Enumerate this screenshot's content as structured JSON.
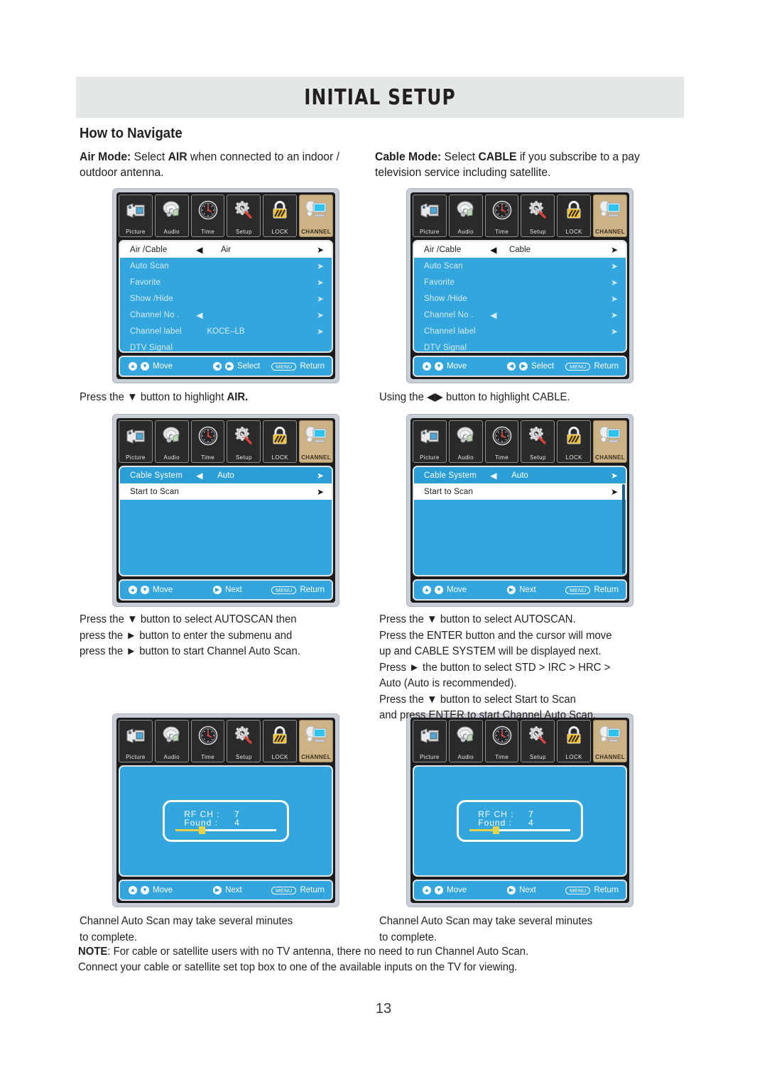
{
  "header": {
    "title": "INITIAL SETUP"
  },
  "section": {
    "title": "How to Navigate"
  },
  "intro": {
    "air_label": "Air Mode:",
    "air_text_1": " Select ",
    "air_bold": "AIR",
    "air_text_2": " when connected to an indoor / outdoor antenna.",
    "cable_label": "Cable Mode:",
    "cable_text_1": " Select ",
    "cable_bold": "CABLE",
    "cable_text_2": " if you subscribe to a pay television service including satellite."
  },
  "icons": [
    {
      "name": "picture",
      "label": "Picture"
    },
    {
      "name": "audio",
      "label": "Audio"
    },
    {
      "name": "time",
      "label": "Time"
    },
    {
      "name": "setup",
      "label": "Setup"
    },
    {
      "name": "lock",
      "label": "LOCK"
    },
    {
      "name": "channel",
      "label": "CHANNEL"
    }
  ],
  "hints": {
    "move": "Move",
    "select": "Select",
    "next": "Next",
    "return": "Return",
    "menu_key": "MENU"
  },
  "osd_air_menu": {
    "rows": [
      {
        "label": "Air /Cable",
        "value": "Air",
        "left_arrow": true,
        "right_arrow": true,
        "selected": true
      },
      {
        "label": "Auto  Scan",
        "value": "",
        "left_arrow": false,
        "right_arrow": true,
        "selected": false
      },
      {
        "label": "Favorite",
        "value": "",
        "left_arrow": false,
        "right_arrow": true,
        "selected": false
      },
      {
        "label": "Show /Hide",
        "value": "",
        "left_arrow": false,
        "right_arrow": true,
        "selected": false
      },
      {
        "label": "Channel No .",
        "value": "",
        "left_arrow": true,
        "right_arrow": true,
        "selected": false
      },
      {
        "label": "Channel label",
        "value": "KOCE–LB",
        "left_arrow": false,
        "right_arrow": true,
        "selected": false
      },
      {
        "label": "DTV  Signal",
        "value": "",
        "left_arrow": false,
        "right_arrow": false,
        "selected": false
      }
    ]
  },
  "osd_cable_menu": {
    "rows": [
      {
        "label": "Air /Cable",
        "value": "Cable",
        "left_arrow": true,
        "right_arrow": true,
        "selected": true
      },
      {
        "label": "Auto  Scan",
        "value": "",
        "left_arrow": false,
        "right_arrow": true,
        "selected": false
      },
      {
        "label": "Favorite",
        "value": "",
        "left_arrow": false,
        "right_arrow": true,
        "selected": false
      },
      {
        "label": "Show /Hide",
        "value": "",
        "left_arrow": false,
        "right_arrow": true,
        "selected": false
      },
      {
        "label": "Channel No .",
        "value": "",
        "left_arrow": true,
        "right_arrow": true,
        "selected": false
      },
      {
        "label": "Channel label",
        "value": "",
        "left_arrow": false,
        "right_arrow": true,
        "selected": false
      },
      {
        "label": "DTV  Signal",
        "value": "",
        "left_arrow": false,
        "right_arrow": false,
        "selected": false
      }
    ]
  },
  "osd_scan_menu": {
    "rows": [
      {
        "label": "Cable System",
        "value": "Auto",
        "left_arrow": true,
        "right_arrow": true,
        "highlight": "blue"
      },
      {
        "label": "Start  to Scan",
        "value": "",
        "left_arrow": false,
        "right_arrow": true,
        "highlight": "white"
      }
    ]
  },
  "osd_progress": {
    "rf_ch_label": "RF  CH :",
    "rf_ch_value": "7",
    "found_label": "Found :",
    "found_value": "4",
    "progress_percent": 23
  },
  "captions": {
    "air_step1": "Press the ▼ button to highlight ",
    "air_step1_bold": "AIR.",
    "cable_step1": "Using the ◀▶ button to highlight CABLE.",
    "air_step2_l1": "Press the ▼ button to select AUTOSCAN then",
    "air_step2_l2": "press the ► button to enter the submenu and",
    "air_step2_l3": "press the ► button to start Channel Auto Scan.",
    "cable_step2_l1": "Press the ▼ button to select AUTOSCAN.",
    "cable_step2_l2": "Press the ENTER button and the cursor will move",
    "cable_step2_l3": "up and CABLE SYSTEM will be displayed next.",
    "cable_step2_l4": " Press ► the button to select STD > IRC > HRC >",
    "cable_step2_l5": "Auto (Auto is recommended).",
    "cable_step2_l6": " Press the ▼ button to select Start to Scan",
    "cable_step2_l7": "and press ENTER to start Channel Auto Scan.",
    "air_step3_l1": "Channel Auto Scan may take several minutes",
    "air_step3_l2": "to complete.",
    "cable_step3_l1": "Channel Auto Scan may take several minutes",
    "cable_step3_l2": "to complete."
  },
  "note": {
    "label": "NOTE",
    "line1": ": For cable or satellite users with no TV antenna, there no need to run Channel Auto Scan.",
    "line2": " Connect your cable or satellite set top box to one of the available inputs on the TV for viewing."
  },
  "page_number": "13",
  "colors": {
    "osd_blue": "#33a6dd",
    "osd_accent_tan": "#cdb285",
    "progress_yellow": "#e8d44a",
    "header_band": "#e3e7e8"
  }
}
